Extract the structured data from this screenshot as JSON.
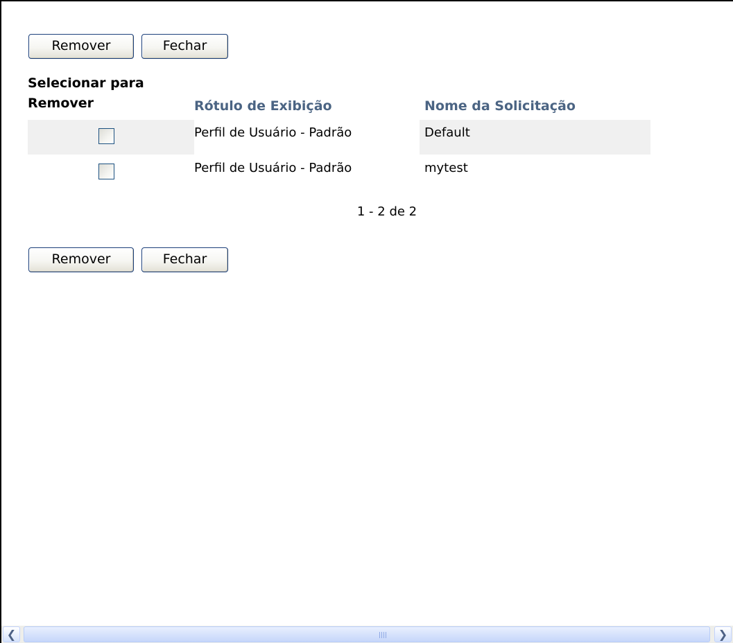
{
  "buttons": {
    "remove_label": "Remover",
    "close_label": "Fechar"
  },
  "table": {
    "headers": {
      "select": "Selecionar para Remover",
      "display_label": "Rótulo de Exibição",
      "request_name": "Nome da Solicitação"
    },
    "rows": [
      {
        "display_label": "Perfil de Usuário - Padrão",
        "request_name": "Default",
        "checked": false
      },
      {
        "display_label": "Perfil de Usuário - Padrão",
        "request_name": "mytest",
        "checked": false
      }
    ]
  },
  "pager": {
    "text": "1 - 2 de 2"
  },
  "icons": {
    "scroll_left": "chevron-left-icon",
    "scroll_right": "chevron-right-icon"
  },
  "colors": {
    "header_link": "#4b6483",
    "row_alt": "#f0f0f0",
    "button_border": "#1b3f7a"
  }
}
